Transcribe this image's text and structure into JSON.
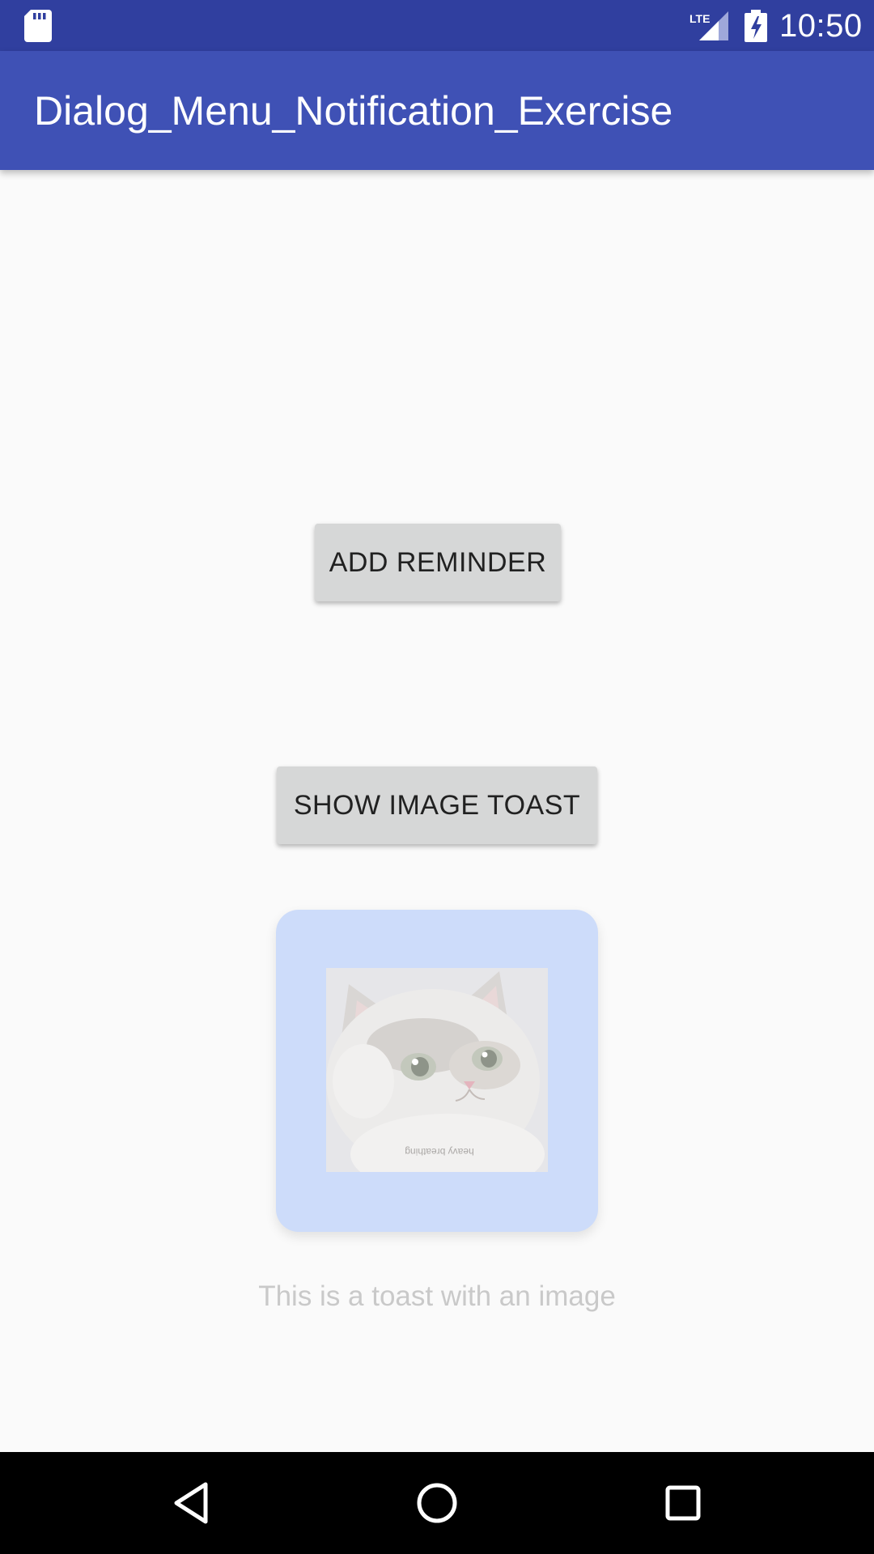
{
  "status_bar": {
    "network_label": "LTE",
    "time": "10:50",
    "icons": [
      "sd-card-icon",
      "lte-signal-icon",
      "battery-charging-icon"
    ],
    "background": "#303f9f"
  },
  "app_bar": {
    "title": "Dialog_Menu_Notification_Exercise",
    "background": "#3f51b5"
  },
  "buttons": {
    "add_reminder": "ADD REMINDER",
    "show_image_toast": "SHOW IMAGE TOAST"
  },
  "toast": {
    "image_icon": "cat-photo",
    "image_watermark": "heavy breathing",
    "caption": "This is a toast with an image",
    "background": "#cddcfa"
  },
  "nav_bar": {
    "icons": [
      "back-icon",
      "home-icon",
      "recents-icon"
    ],
    "background": "#000000"
  }
}
